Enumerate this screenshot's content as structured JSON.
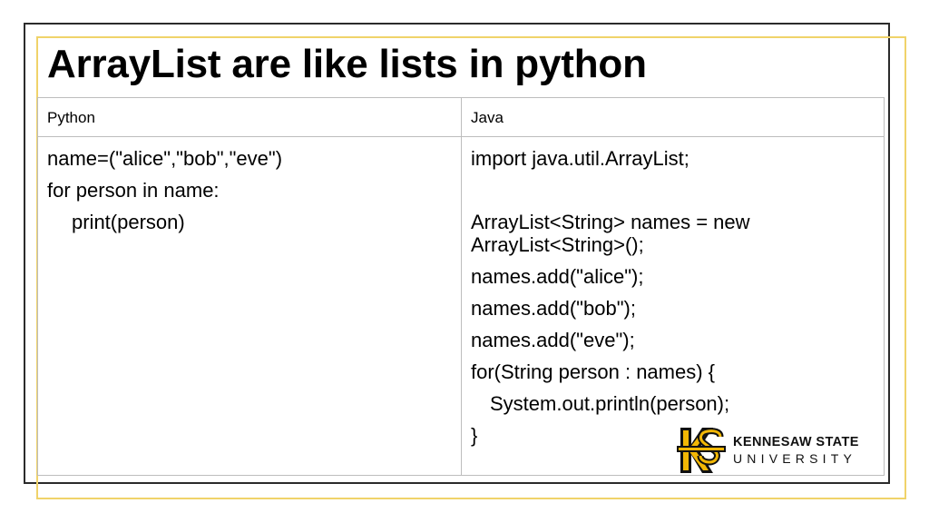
{
  "slide": {
    "title": "ArrayList are like lists in python"
  },
  "table": {
    "headers": [
      "Python",
      "Java"
    ],
    "python_lines": [
      "name=(\"alice\",\"bob\",\"eve\")",
      "for person in name:",
      "print(person)"
    ],
    "java_lines": [
      "import java.util.ArrayList;",
      "",
      "ArrayList<String> names = new ArrayList<String>();",
      "names.add(\"alice\");",
      "names.add(\"bob\");",
      "names.add(\"eve\");",
      "for(String person : names) {",
      "System.out.println(person);",
      "}"
    ]
  },
  "logo": {
    "line1": "KENNESAW STATE",
    "line2": "UNIVERSITY",
    "icon": "ksu-monogram-icon",
    "colors": {
      "gold": "#f2b705",
      "black": "#111111"
    }
  },
  "colors": {
    "frame_dark": "#2b2b2b",
    "frame_accent": "#f0d36a",
    "grid": "#bdbdbd"
  }
}
